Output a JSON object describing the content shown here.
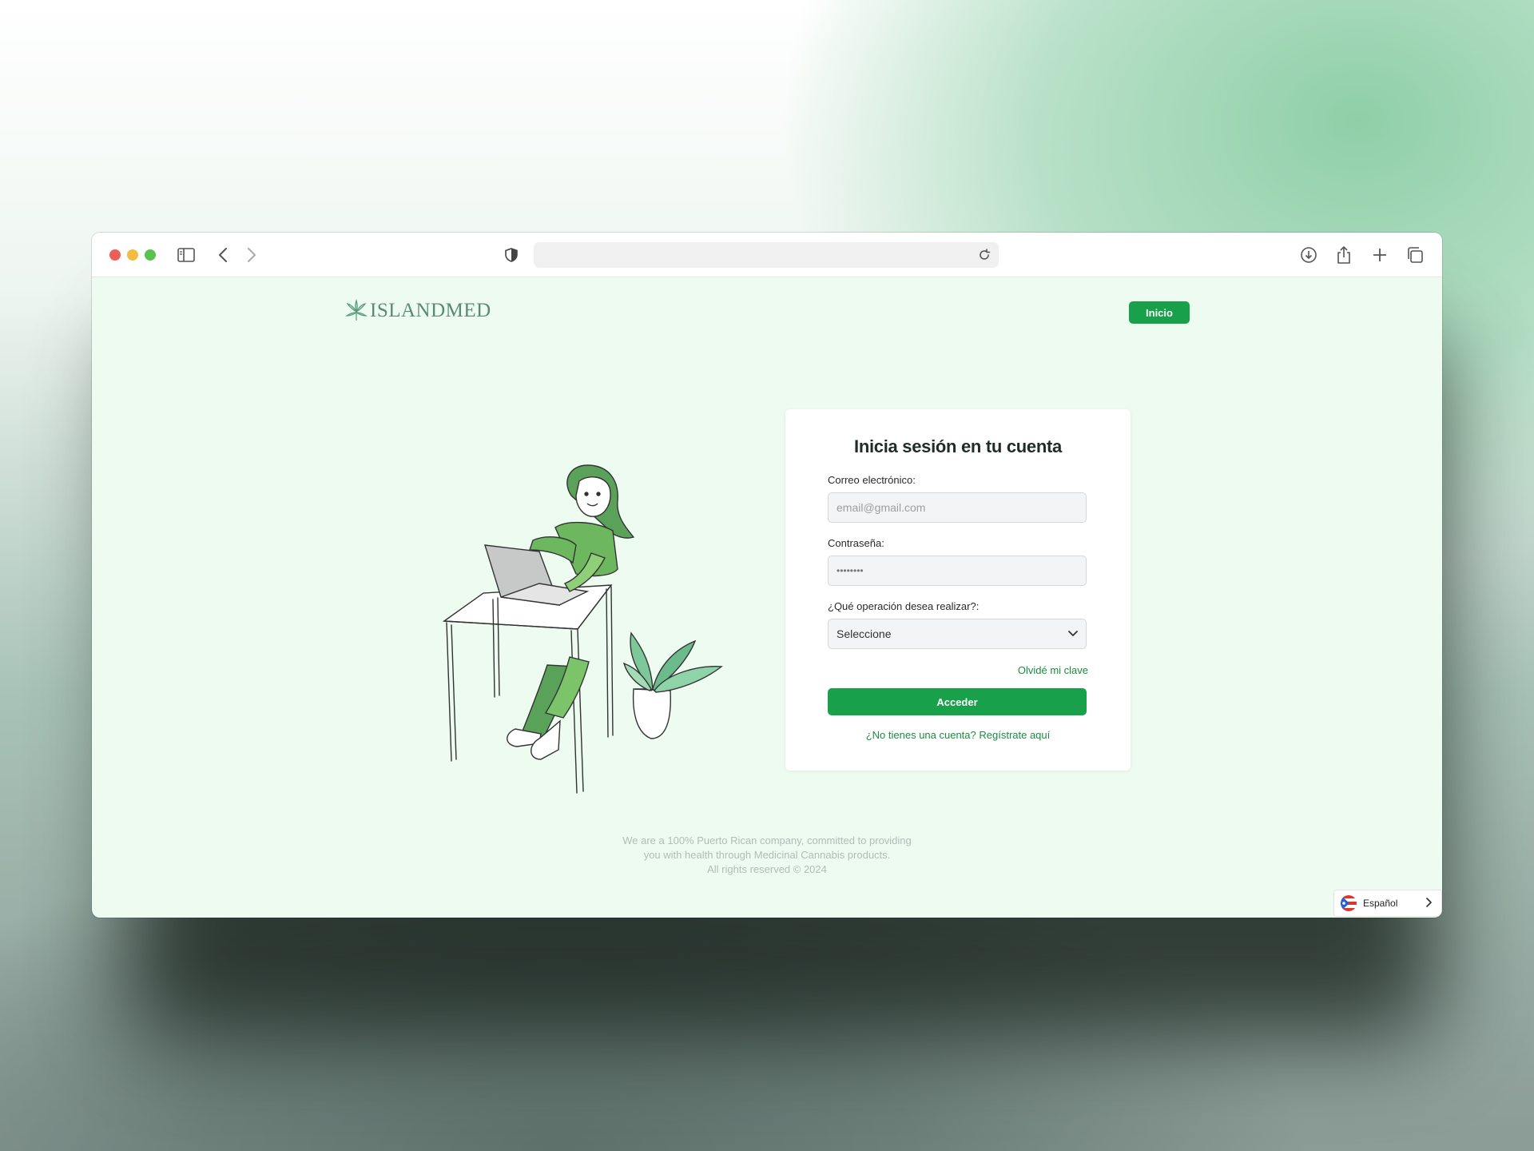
{
  "browser": {
    "url": "",
    "icons": [
      "sidebar-icon",
      "back-icon",
      "forward-icon",
      "shield-icon",
      "reload-icon",
      "download-icon",
      "share-icon",
      "new-tab-icon",
      "tabs-overview-icon"
    ]
  },
  "header": {
    "logo_text": "ISLANDMED",
    "nav_button": "Inicio"
  },
  "login": {
    "title": "Inicia sesión en tu cuenta",
    "email_label": "Correo electrónico:",
    "email_placeholder": "email@gmail.com",
    "password_label": "Contraseña:",
    "password_value": "••••••••",
    "operation_label": "¿Qué operación desea realizar?:",
    "operation_selected": "Seleccione",
    "forgot_link": "Olvidé mi clave",
    "submit_label": "Acceder",
    "register_link": "¿No tienes una cuenta? Regístrate aquí"
  },
  "footer": {
    "line1": "We are a 100% Puerto Rican company, committed to providing",
    "line2": "you with health through Medicinal Cannabis products.",
    "line3": "All rights reserved © 2024"
  },
  "language": {
    "label": "Español",
    "flag": "puerto-rico-flag"
  },
  "colors": {
    "accent": "#18a04a",
    "page_bg": "#edfbf0",
    "link": "#1a8c3e"
  }
}
